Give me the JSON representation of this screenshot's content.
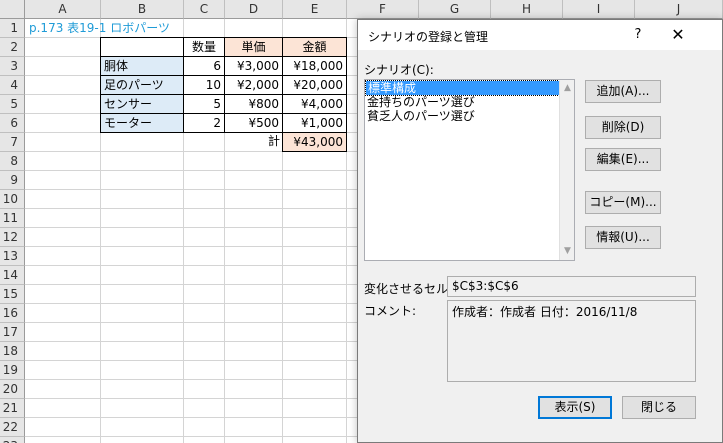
{
  "columns": [
    "A",
    "B",
    "C",
    "D",
    "E",
    "F",
    "G",
    "H",
    "I",
    "J"
  ],
  "rows": [
    "1",
    "2",
    "3",
    "4",
    "5",
    "6",
    "7",
    "8",
    "9",
    "10",
    "11",
    "12",
    "13",
    "14",
    "15",
    "16",
    "17",
    "18",
    "19",
    "20",
    "21",
    "22",
    "23"
  ],
  "sheet": {
    "title": "p.173 表19-1 ロボパーツ",
    "headers": {
      "qty": "数量",
      "price": "単価",
      "amount": "金額"
    },
    "items": [
      {
        "name": "胴体",
        "qty": "6",
        "price": "¥3,000",
        "amount": "¥18,000"
      },
      {
        "name": "足のパーツ",
        "qty": "10",
        "price": "¥2,000",
        "amount": "¥20,000"
      },
      {
        "name": "センサー",
        "qty": "5",
        "price": "¥800",
        "amount": "¥4,000"
      },
      {
        "name": "モーター",
        "qty": "2",
        "price": "¥500",
        "amount": "¥1,000"
      }
    ],
    "total_label": "計",
    "total_value": "¥43,000"
  },
  "dialog": {
    "title": "シナリオの登録と管理",
    "help": "?",
    "close": "✕",
    "scenarios_label": "シナリオ(C):",
    "scenarios": [
      "標準構成",
      "金持ちのパーツ選び",
      "貧乏人のパーツ選び"
    ],
    "buttons": {
      "add": "追加(A)...",
      "delete": "削除(D)",
      "edit": "編集(E)...",
      "copy": "コピー(M)...",
      "info": "情報(U)...",
      "show": "表示(S)",
      "close": "閉じる"
    },
    "changing_cells_label": "変化させるセル:",
    "changing_cells_value": "$C$3:$C$6",
    "comment_label": "コメント:",
    "comment_value": "作成者：作成者 日付：2016/11/8"
  },
  "colors": {
    "accent": "#0078d7",
    "selection": "#3399ff",
    "blue_cell": "#ddebf7",
    "peach_cell": "#fce4d6",
    "title_text": "#1f9bd7"
  }
}
